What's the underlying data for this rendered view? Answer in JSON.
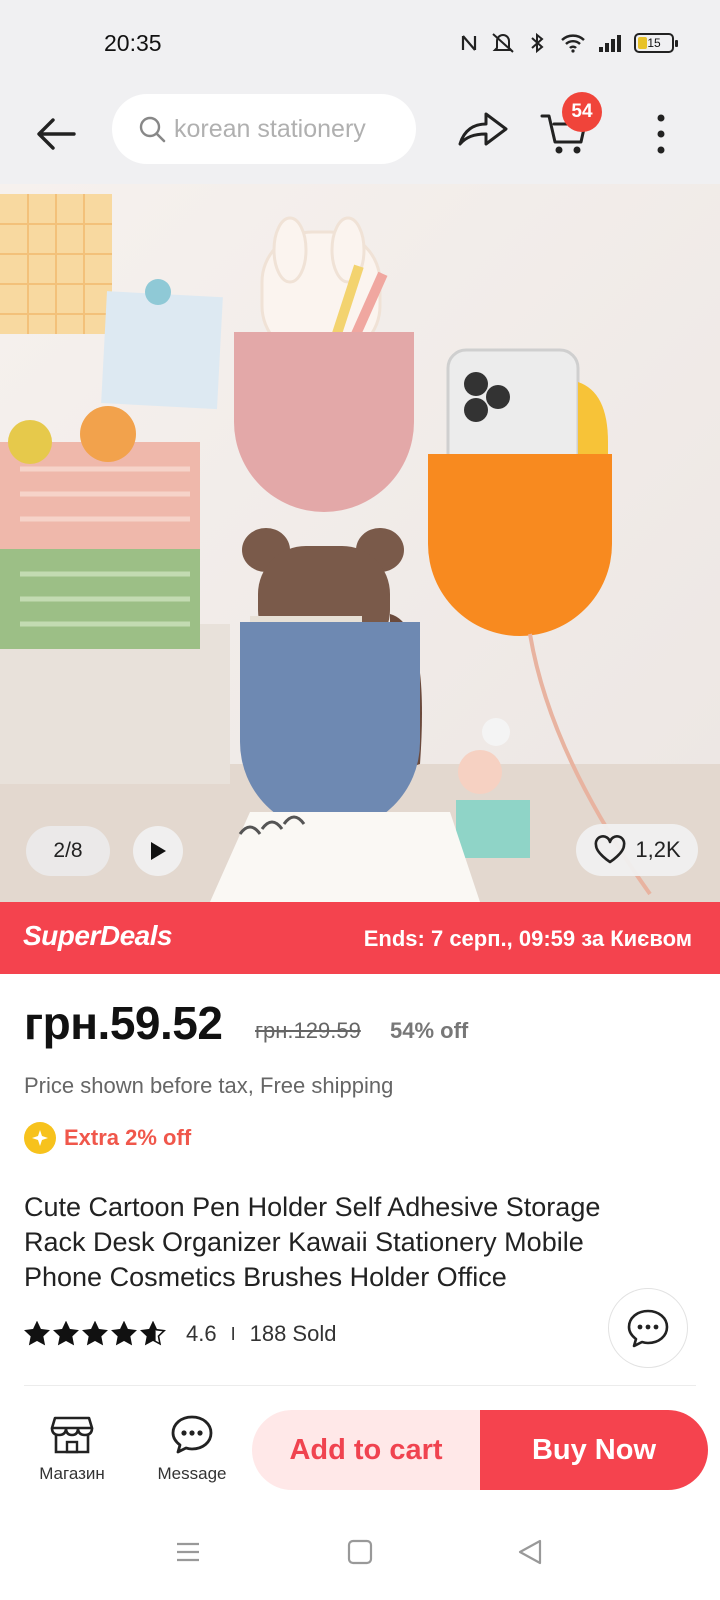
{
  "status_bar": {
    "time": "20:35",
    "battery_level": "15",
    "icons": [
      "nfc-icon",
      "mute-icon",
      "bluetooth-icon",
      "wifi-icon",
      "signal-icon",
      "battery-icon"
    ]
  },
  "header": {
    "search_placeholder": "korean stationery",
    "cart_count": "54",
    "icons": [
      "back-arrow-icon",
      "search-icon",
      "share-icon",
      "cart-icon",
      "more-vertical-icon"
    ]
  },
  "gallery": {
    "counter": "2/8",
    "wishlist_count": "1,2K",
    "icons": [
      "play-icon",
      "heart-icon"
    ]
  },
  "deals": {
    "logo": "SuperDeals",
    "ends": "Ends: 7 серп., 09:59 за Києвом",
    "accent_color": "#f4434e"
  },
  "price": {
    "current": "грн.59.52",
    "original": "грн.129.59",
    "discount": "54% off",
    "note": "Price shown before tax, Free shipping",
    "extra": "Extra 2% off"
  },
  "product": {
    "title": "Cute Cartoon Pen Holder Self Adhesive Storage Rack Desk Organizer Kawaii Stationery Mobile Phone Cosmetics Brushes Holder Office",
    "rating": "4.6",
    "rating_stars": 4.6,
    "separator": "I",
    "sold": "188 Sold"
  },
  "bottom_bar": {
    "store_label": "Магазин",
    "message_label": "Message",
    "add_to_cart": "Add to cart",
    "buy_now": "Buy Now"
  },
  "nav_bar": {
    "icons": [
      "menu-icon",
      "home-square-icon",
      "back-triangle-icon"
    ]
  }
}
